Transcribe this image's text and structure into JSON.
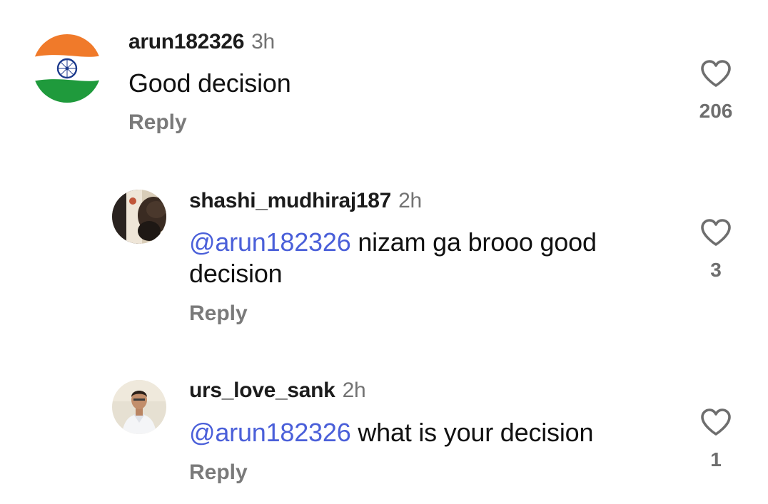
{
  "comments": [
    {
      "username": "arun182326",
      "time": "3h",
      "text": "Good decision",
      "reply_label": "Reply",
      "likes": "206",
      "avatar": "india-flag"
    },
    {
      "username": "shashi_mudhiraj187",
      "time": "2h",
      "mention": "@arun182326",
      "text": " nizam ga brooo good decision",
      "reply_label": "Reply",
      "likes": "3",
      "avatar": "person-photo"
    },
    {
      "username": "urs_love_sank",
      "time": "2h",
      "mention": "@arun182326",
      "text": " what is your decision",
      "reply_label": "Reply",
      "likes": "1",
      "avatar": "person-photo"
    }
  ],
  "colors": {
    "mention": "#4a5fd9",
    "secondary_text": "#737373",
    "reply": "#7a7a7a"
  },
  "icons": {
    "like": "heart-outline-icon"
  }
}
